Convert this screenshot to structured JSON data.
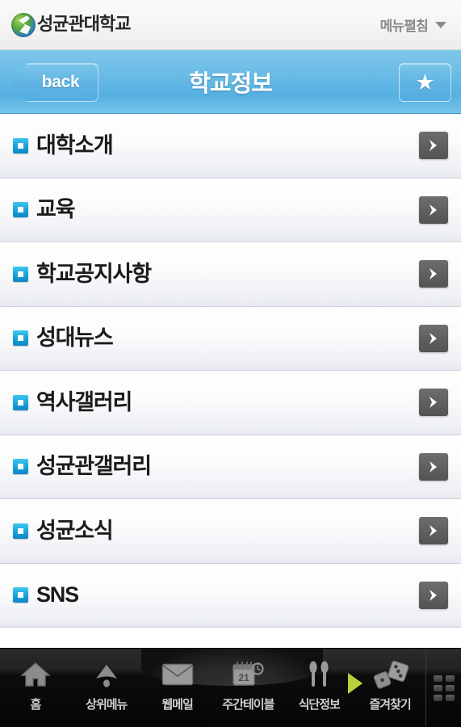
{
  "brand": {
    "logo_icon": "skku-globe-logo-icon",
    "name": "성균관대학교",
    "menu_toggle_label": "메뉴펼침",
    "caret_icon": "chevron-down-icon"
  },
  "titlebar": {
    "back_label": "back",
    "title": "학교정보",
    "favorite_icon": "star-icon",
    "accent_color": "#63b9e6"
  },
  "list": {
    "bullet_icon": "square-bullet-icon",
    "chevron_icon": "chevron-right-icon",
    "items": [
      {
        "label": "대학소개"
      },
      {
        "label": "교육"
      },
      {
        "label": "학교공지사항"
      },
      {
        "label": "성대뉴스"
      },
      {
        "label": "역사갤러리"
      },
      {
        "label": "성균관갤러리"
      },
      {
        "label": "성균소식"
      },
      {
        "label": "SNS"
      }
    ]
  },
  "tabbar": {
    "tabs": [
      {
        "label": "홈",
        "icon": "home-icon"
      },
      {
        "label": "상위메뉴",
        "icon": "up-arrow-icon"
      },
      {
        "label": "웹메일",
        "icon": "envelope-icon"
      },
      {
        "label": "주간테이블",
        "icon": "calendar-clock-icon",
        "day": "21"
      },
      {
        "label": "식단정보",
        "icon": "utensils-icon"
      },
      {
        "label": "즐겨찾기",
        "icon": "dice-icon"
      }
    ],
    "grid_icon": "app-grid-icon",
    "play_marker_color": "#b7d23a"
  }
}
